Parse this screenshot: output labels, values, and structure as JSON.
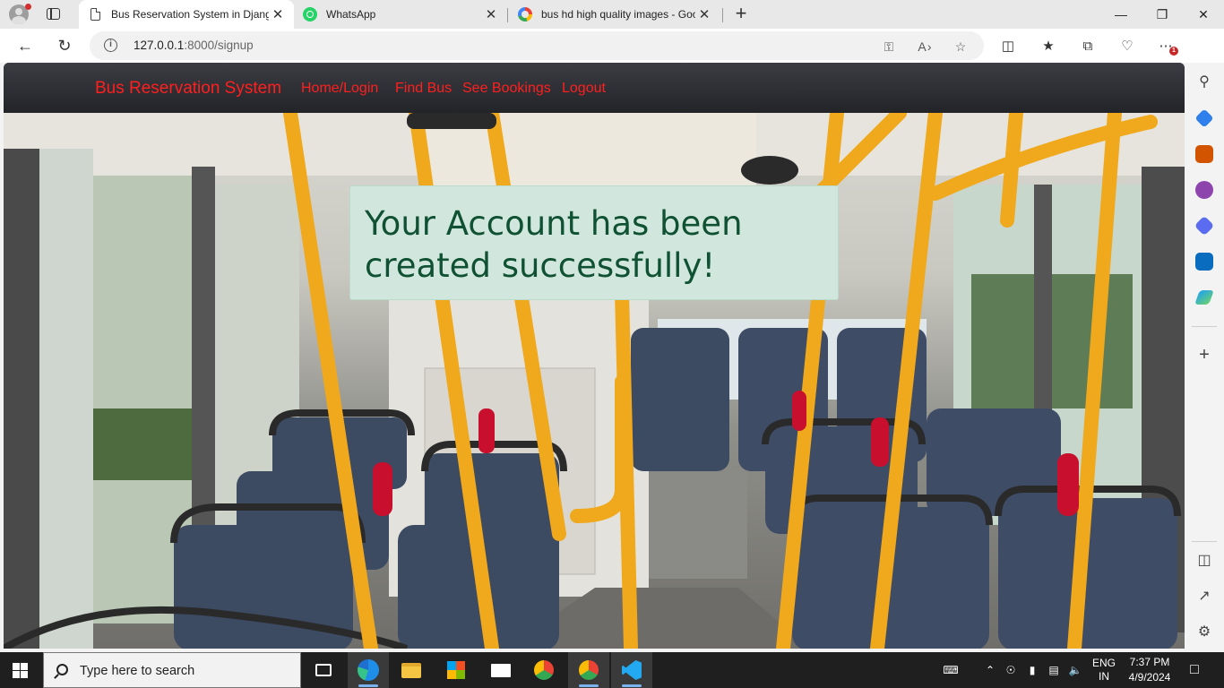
{
  "browser": {
    "tabs": [
      {
        "title": "Bus Reservation System in Djang",
        "favicon": "document-icon",
        "active": true
      },
      {
        "title": "WhatsApp",
        "favicon": "whatsapp-icon",
        "active": false
      },
      {
        "title": "bus hd high quality images - Goo",
        "favicon": "google-icon",
        "active": false
      }
    ],
    "url_host": "127.0.0.1",
    "url_rest": ":8000/signup",
    "extension_badge": "1"
  },
  "site": {
    "brand": "Bus Reservation System",
    "nav": [
      {
        "label": "Home/Login"
      },
      {
        "label": "Find Bus"
      },
      {
        "label": "See Bookings"
      },
      {
        "label": "Logout"
      }
    ],
    "alert_message": "Your Account has been created successfully!"
  },
  "taskbar": {
    "search_placeholder": "Type here to search",
    "language": "ENG",
    "region": "IN",
    "time": "7:37 PM",
    "date": "4/9/2024"
  },
  "colors": {
    "nav_link": "#ff1f1f",
    "alert_bg": "#d1e7dd",
    "alert_text": "#0f5132"
  }
}
